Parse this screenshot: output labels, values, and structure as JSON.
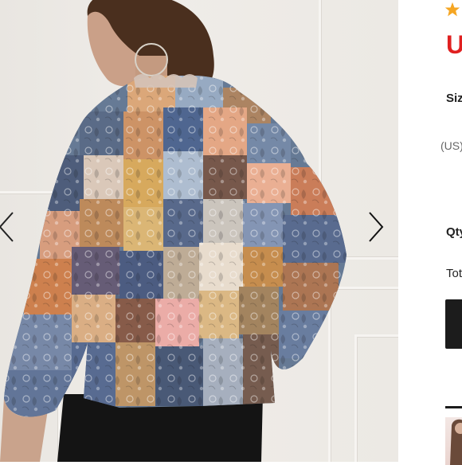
{
  "product": {
    "image_alt": "Paisley patchwork sheer blouse, back view",
    "price": "U",
    "size_label": "Siz",
    "size_unit": "(US)",
    "qty_label": "Qty",
    "total_label": "Tota"
  },
  "icons": {
    "prev": "chevron-left-icon",
    "next": "chevron-right-icon",
    "rating": "star-icon"
  },
  "colors": {
    "price": "#e02020",
    "rating_star": "#f5a623",
    "button": "#1c1c1c"
  }
}
